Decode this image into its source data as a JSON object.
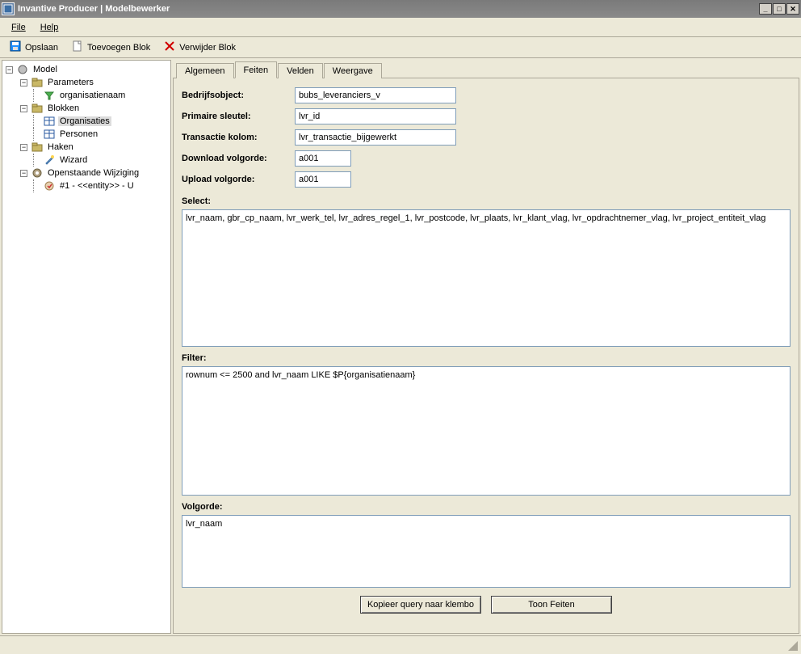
{
  "window": {
    "title": "Invantive Producer | Modelbewerker"
  },
  "menu": {
    "file": "File",
    "help": "Help"
  },
  "toolbar": {
    "save": "Opslaan",
    "add_block": "Toevoegen Blok",
    "remove_block": "Verwijder Blok"
  },
  "tree": {
    "root": "Model",
    "parameters": "Parameters",
    "param_item": "organisatienaam",
    "blocks": "Blokken",
    "block_items": [
      "Organisaties",
      "Personen"
    ],
    "hooks": "Haken",
    "hook_item": "Wizard",
    "pending": "Openstaande Wijziging",
    "pending_item": "#1 - <<entity>> - U"
  },
  "tabs": {
    "general": "Algemeen",
    "facts": "Feiten",
    "fields": "Velden",
    "display": "Weergave"
  },
  "form": {
    "business_object_lbl": "Bedrijfsobject:",
    "business_object_val": "bubs_leveranciers_v",
    "primary_key_lbl": "Primaire sleutel:",
    "primary_key_val": "lvr_id",
    "txn_col_lbl": "Transactie kolom:",
    "txn_col_val": "lvr_transactie_bijgewerkt",
    "download_order_lbl": "Download volgorde:",
    "download_order_val": "a001",
    "upload_order_lbl": "Upload volgorde:",
    "upload_order_val": "a001",
    "select_lbl": "Select:",
    "select_val": "lvr_naam, gbr_cp_naam, lvr_werk_tel, lvr_adres_regel_1, lvr_postcode, lvr_plaats, lvr_klant_vlag, lvr_opdrachtnemer_vlag, lvr_project_entiteit_vlag",
    "filter_lbl": "Filter:",
    "filter_val": "rownum <= 2500 and lvr_naam LIKE $P{organisatienaam}",
    "order_lbl": "Volgorde:",
    "order_val": "lvr_naam"
  },
  "buttons": {
    "copy_query": "Kopieer query naar klembo",
    "show_facts": "Toon Feiten"
  }
}
